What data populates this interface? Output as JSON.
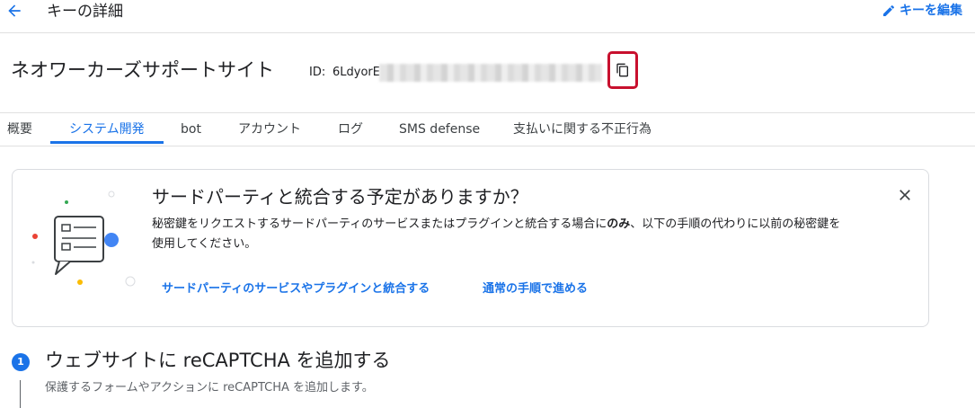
{
  "header": {
    "back_icon": "arrow-left-icon",
    "title": "キーの詳細",
    "edit_label": "キーを編集",
    "edit_icon": "pencil-icon"
  },
  "key": {
    "name": "ネオワーカーズサポートサイト",
    "id_label": "ID:",
    "id_value": "6LdyorE",
    "copy_icon": "copy-icon"
  },
  "tabs": [
    {
      "label": "概要",
      "active": false
    },
    {
      "label": "システム開発",
      "active": true
    },
    {
      "label": "bot",
      "active": false
    },
    {
      "label": "アカウント",
      "active": false
    },
    {
      "label": "ログ",
      "active": false
    },
    {
      "label": "SMS defense",
      "active": false
    },
    {
      "label": "支払いに関する不正行為",
      "active": false
    }
  ],
  "card": {
    "title": "サードパーティと統合する予定がありますか？",
    "body_part1": "秘密鍵をリクエストするサードパーティのサービスまたはプラグインと統合する場合に",
    "body_strong": "のみ",
    "body_part2": "、以下の手順の代わりに以前の秘密鍵を",
    "body_line2": "使用してください。",
    "link_integrate": "サードパーティのサービスやプラグインと統合する",
    "link_normal": "通常の手順で進める",
    "close_icon": "close-icon"
  },
  "step": {
    "number": "1",
    "title": "ウェブサイトに reCAPTCHA を追加する",
    "description": "保護するフォームやアクションに reCAPTCHA を追加します。"
  },
  "colors": {
    "accent": "#1a73e8",
    "highlight": "#c8102e",
    "text": "#202124",
    "muted": "#5f6368",
    "border": "#dadce0"
  }
}
